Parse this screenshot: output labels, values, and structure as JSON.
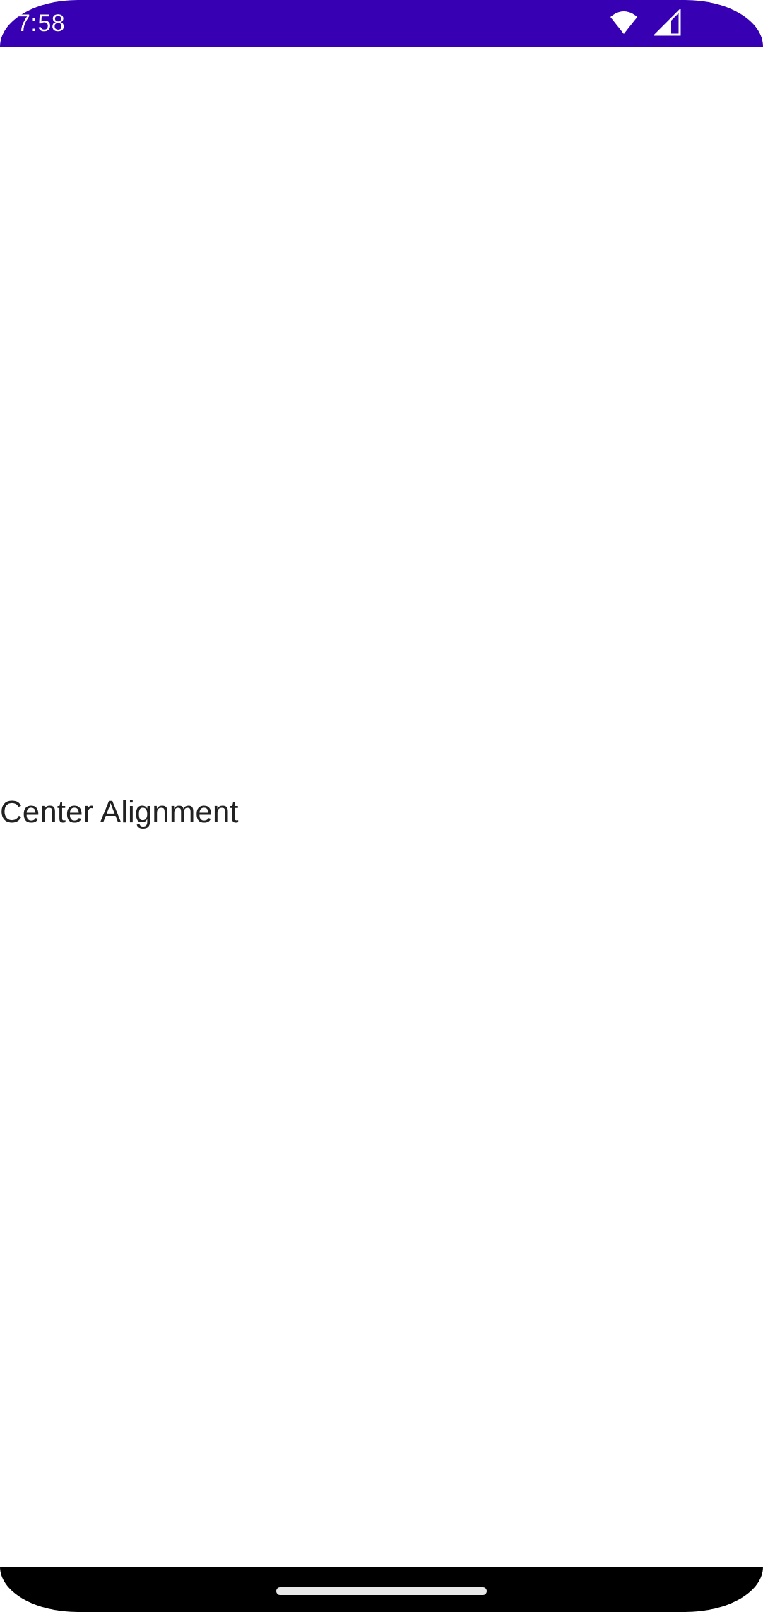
{
  "status_bar": {
    "time": "7:58",
    "background_color": "#3700b3",
    "icons": [
      "wifi-icon",
      "cellular-signal-icon"
    ]
  },
  "content": {
    "label": "Center Alignment",
    "text_color": "#212121"
  },
  "navigation": {
    "handle": "home-gesture-handle"
  }
}
